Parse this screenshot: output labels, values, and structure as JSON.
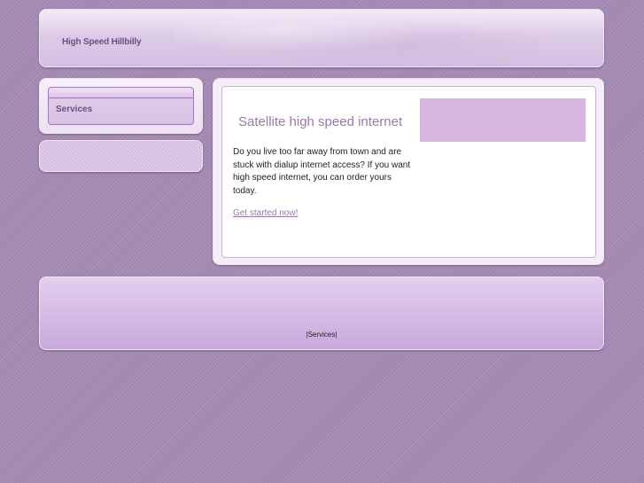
{
  "header": {
    "site_title": "High Speed Hillbilly"
  },
  "nav": {
    "items": [
      {
        "label": "Services"
      }
    ]
  },
  "main": {
    "heading": "Satellite high speed internet",
    "intro": "Do you live too far away from town and are stuck with dialup internet access? If you want high speed internet, you can order yours today.",
    "cta_label": "Get started now!"
  },
  "footer": {
    "sep_left": "|",
    "link_services": "Services",
    "sep_right": "|"
  },
  "colors": {
    "background": "#a68bb5",
    "accent": "#9a78ad",
    "title_text": "#6d4d86",
    "image_block": "#d7b6e2"
  }
}
